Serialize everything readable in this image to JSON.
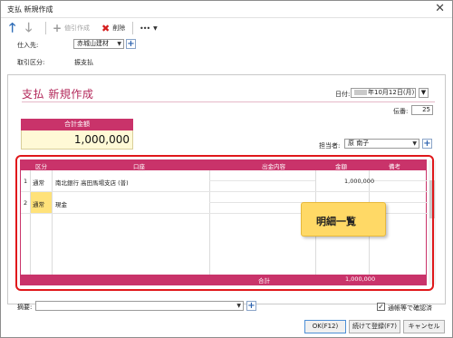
{
  "window": {
    "title": "支払 新規作成",
    "close_glyph": "✕"
  },
  "toolbar": {
    "up_glyph": "🡑",
    "down_glyph": "🡓",
    "make_deduction_label": "値引作成",
    "delete_label": "削除",
    "more_glyph": "•••",
    "more_caret": "▼"
  },
  "header_fields": {
    "supplier_label": "仕入先:",
    "supplier_value": "赤城山建材",
    "trade_type_label": "取引区分:",
    "trade_type_value": "振支払"
  },
  "form": {
    "title": "支払 新規作成",
    "date_label": "日付:",
    "date_value": "年10月12日(月)",
    "slip_no_label": "伝番:",
    "slip_no_value": "25",
    "staff_label": "担当者:",
    "staff_value": "原 南子",
    "total_label": "合計金額",
    "total_value": "1,000,000"
  },
  "grid": {
    "headers": [
      "区分",
      "口座",
      "出金内容",
      "金額",
      "備考"
    ],
    "rows": [
      {
        "no": "1",
        "kubun": "通常",
        "account": "南北銀行 高田馬場支店 (普)",
        "amount": "1,000,000"
      },
      {
        "no": "2",
        "kubun": "通常",
        "account": "現金",
        "amount": ""
      }
    ],
    "footer_label": "合計",
    "footer_value": "1,000,000"
  },
  "callout": {
    "text": "明細一覧"
  },
  "bottom": {
    "memo_label": "摘要:",
    "verified_label": "通帳等で確認済",
    "ok_label": "OK(F12)",
    "continue_label": "続けて登録(F7)",
    "cancel_label": "キャンセル"
  },
  "colors": {
    "accent": "#c9336a",
    "highlight_outline": "#e0181b",
    "callout_fill": "#ffd966",
    "kubun_fill": "#ffe27a"
  }
}
